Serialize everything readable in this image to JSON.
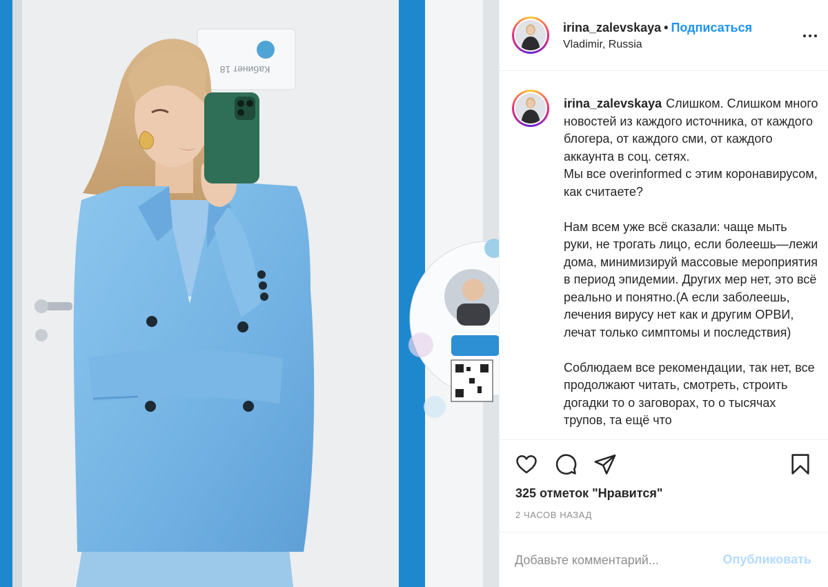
{
  "post": {
    "author": {
      "username": "irina_zalevskaya",
      "location": "Vladimir, Russia"
    },
    "header": {
      "separator": "•",
      "follow_label": "Подписаться",
      "more_icon": "more-horizontal-icon"
    },
    "photo": {
      "door_sign": "Кабинет 18"
    },
    "caption": {
      "username": "irina_zalevskaya",
      "text": "Слишком. Слишком много новостей из каждого источника, от каждого блогера, от каждого сми, от каждого аккаунта в соц. сетях.\nМы все overinformed с этим коронавирусом, как считаете?\n\nНам всем уже всё сказали: чаще мыть руки, не трогать лицо, если болеешь—лежи дома, минимизируй массовые мероприятия в период эпидемии. Других мер нет, это всё реально и понятно.(А если заболеешь, лечения вирусу нет как и другим ОРВИ, лечат только симптомы и последствия)\n\nСоблюдаем все рекомендации, так нет, все продолжают читать, смотреть, строить догадки то о заговорах, то о тысячах трупов, та ещё что"
    },
    "actions": {
      "icons": [
        "heart-icon",
        "comment-icon",
        "share-icon",
        "bookmark-icon"
      ],
      "likes": "325 отметок \"Нравится\"",
      "time_ago": "2 ЧАСОВ НАЗАД"
    },
    "comment_box": {
      "placeholder": "Добавьте комментарий...",
      "publish_label": "Опубликовать"
    },
    "colors": {
      "link_blue": "#1e93f1",
      "publish_disabled": "#b3dbff",
      "muted_text": "#8e8e8e",
      "border": "#efefef",
      "blazer": "#79b9e8"
    }
  }
}
